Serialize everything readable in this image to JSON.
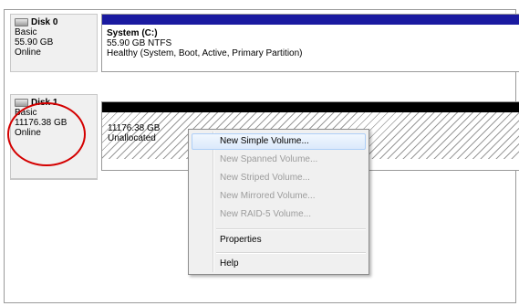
{
  "disks": [
    {
      "name": "Disk 0",
      "type": "Basic",
      "size": "55.90 GB",
      "status": "Online",
      "volume": {
        "name": "System  (C:)",
        "size_fs": "55.90 GB NTFS",
        "health": "Healthy (System, Boot, Active, Primary Partition)",
        "bar_color": "#1a1aa0"
      }
    },
    {
      "name": "Disk 1",
      "type": "Basic",
      "size": "11176.38 GB",
      "status": "Online",
      "volume": {
        "size": "11176.38 GB",
        "state": "Unallocated",
        "bar_color": "#000000"
      }
    }
  ],
  "annotation": {
    "color": "#d40000"
  },
  "context_menu": {
    "items": [
      {
        "label": "New Simple Volume...",
        "enabled": true,
        "selected": true
      },
      {
        "label": "New Spanned Volume...",
        "enabled": false
      },
      {
        "label": "New Striped Volume...",
        "enabled": false
      },
      {
        "label": "New Mirrored Volume...",
        "enabled": false
      },
      {
        "label": "New RAID-5 Volume...",
        "enabled": false
      },
      {
        "label": "Properties",
        "enabled": true
      },
      {
        "label": "Help",
        "enabled": true
      }
    ]
  }
}
